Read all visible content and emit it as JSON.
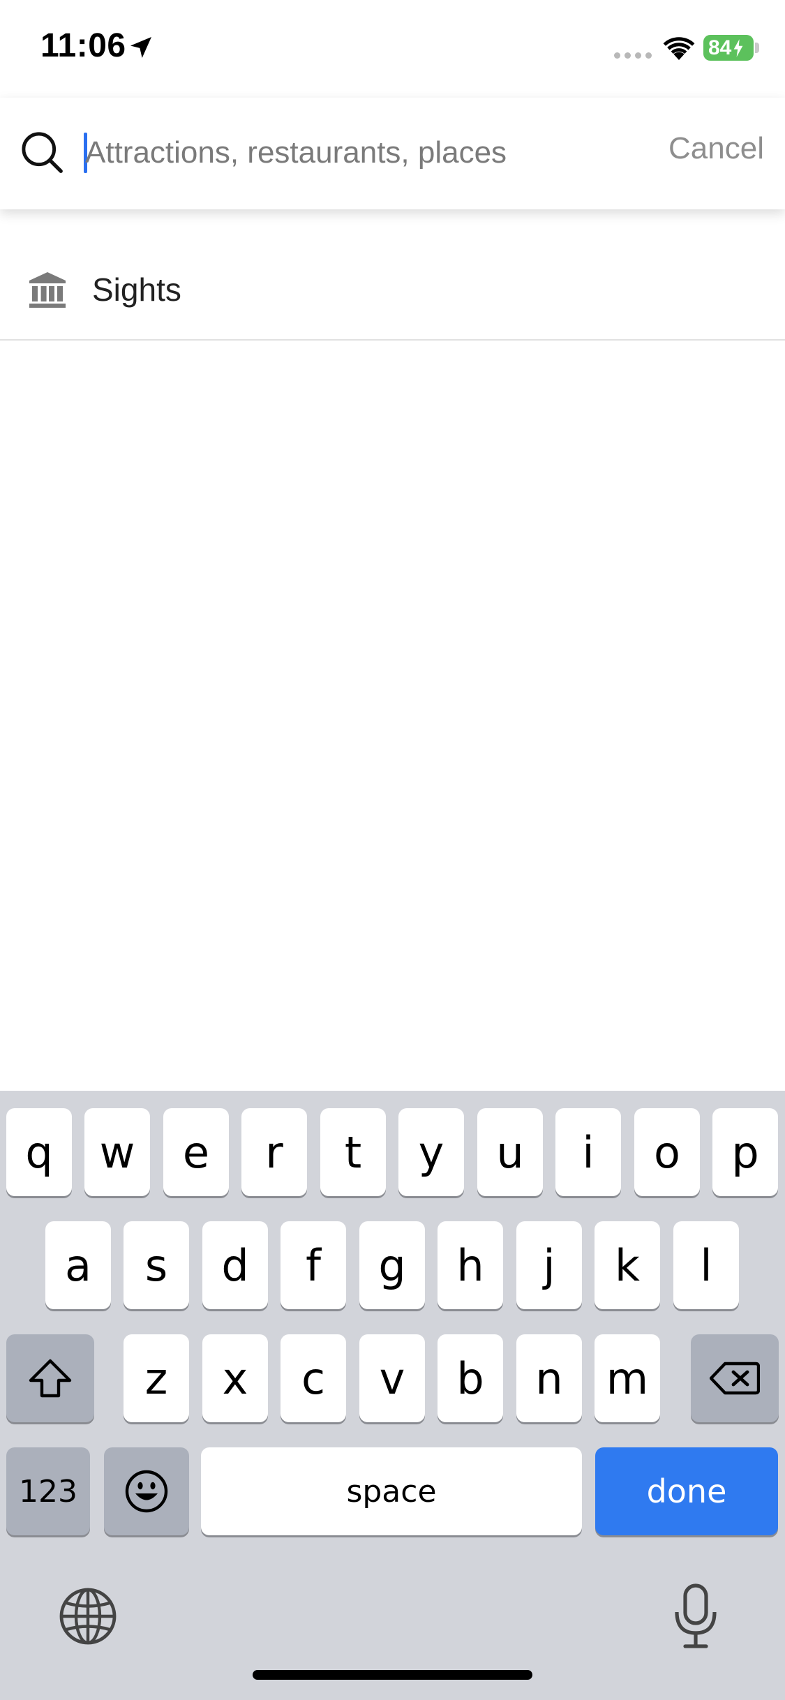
{
  "status_bar": {
    "time": "11:06",
    "battery": "84"
  },
  "search": {
    "placeholder": "Attractions, restaurants, places",
    "value": "",
    "cancel_label": "Cancel"
  },
  "results": {
    "items": [
      {
        "label": "Sights",
        "icon": "museum-icon"
      }
    ]
  },
  "keyboard": {
    "row1": [
      "q",
      "w",
      "e",
      "r",
      "t",
      "y",
      "u",
      "i",
      "o",
      "p"
    ],
    "row2": [
      "a",
      "s",
      "d",
      "f",
      "g",
      "h",
      "j",
      "k",
      "l"
    ],
    "row3": [
      "z",
      "x",
      "c",
      "v",
      "b",
      "n",
      "m"
    ],
    "numbers_label": "123",
    "space_label": "space",
    "done_label": "done",
    "accent_color": "#2f7af0"
  }
}
